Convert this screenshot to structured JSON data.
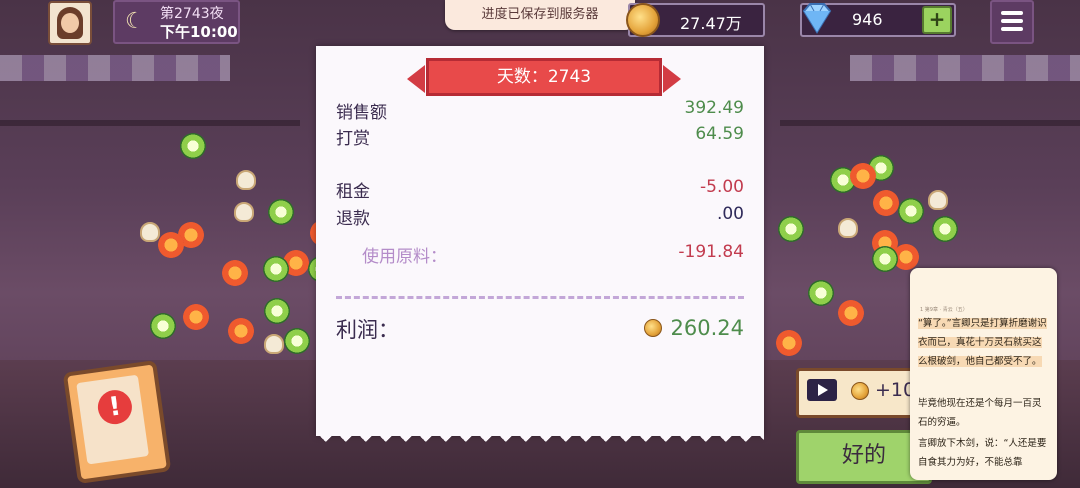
{
  "hud": {
    "night_label": "第2743夜",
    "time_label": "下午10:00",
    "save_toast": "进度已保存到服务器",
    "coins": "27.47万",
    "gems": "946",
    "plus_label": "+"
  },
  "receipt": {
    "day_title": "天数：2743",
    "sales_label": "销售额",
    "sales_value": "392.49",
    "tips_label": "打赏",
    "tips_value": "64.59",
    "rent_label": "租金",
    "rent_value": "-5.00",
    "refund_label": "退款",
    "refund_value": ".00",
    "materials_label": "使用原料：",
    "materials_value": "-191.84",
    "profit_label": "利润：",
    "profit_value": "260.24"
  },
  "actions": {
    "ad_reward_label": "+10",
    "ok_label": "好的"
  },
  "reader": {
    "header": "1 第9章 · 青云（五）",
    "p1": "“算了。”言卿只是打算折磨谢识衣而已，真花十万灵石就买这么根破剑，他自己都受不了。",
    "p2": "毕竟他现在还是个每月一百灵石的穷逼。",
    "p3": "言卿放下木剑，说：“人还是要自食其力为好，不能总靠"
  },
  "colors": {
    "profit_green": "#4e8c4c",
    "loss_red": "#c23b4e",
    "banner_red": "#e84a4a",
    "ok_green": "#9fd36b"
  }
}
